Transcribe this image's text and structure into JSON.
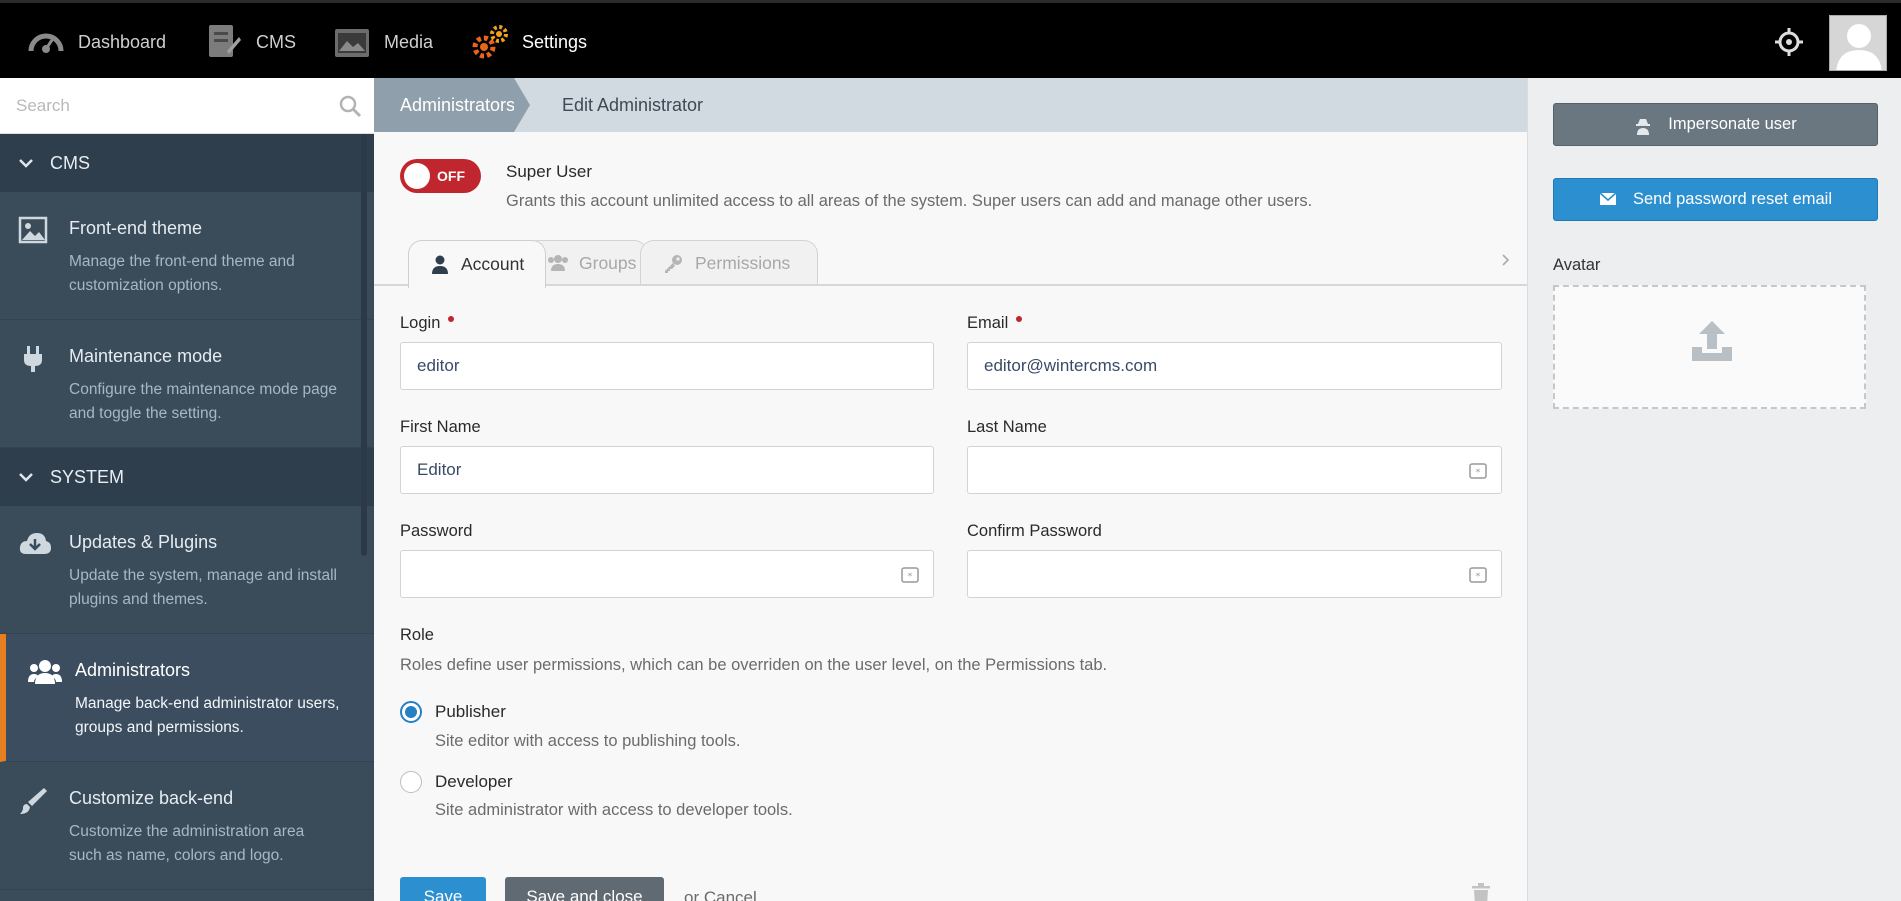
{
  "topnav": {
    "items": [
      {
        "label": "Dashboard",
        "icon": "dashboard-icon"
      },
      {
        "label": "CMS",
        "icon": "cms-icon"
      },
      {
        "label": "Media",
        "icon": "media-icon"
      },
      {
        "label": "Settings",
        "icon": "settings-icon",
        "active": true
      }
    ],
    "locate_icon": "crosshair-icon",
    "avatar_icon": "user-avatar-icon"
  },
  "sidebar": {
    "search_placeholder": "Search",
    "groups": [
      {
        "label": "CMS",
        "items": [
          {
            "title": "Front-end theme",
            "desc": "Manage the front-end theme and customization options.",
            "icon": "image-icon"
          },
          {
            "title": "Maintenance mode",
            "desc": "Configure the maintenance mode page and toggle the setting.",
            "icon": "plug-icon"
          }
        ]
      },
      {
        "label": "SYSTEM",
        "items": [
          {
            "title": "Updates & Plugins",
            "desc": "Update the system, manage and install plugins and themes.",
            "icon": "cloud-download-icon"
          },
          {
            "title": "Administrators",
            "desc": "Manage back-end administrator users, groups and permissions.",
            "icon": "users-icon",
            "active": true
          },
          {
            "title": "Customize back-end",
            "desc": "Customize the administration area such as name, colors and logo.",
            "icon": "brush-icon"
          }
        ]
      }
    ]
  },
  "breadcrumb": {
    "parent": "Administrators",
    "current": "Edit Administrator"
  },
  "form": {
    "super_user": {
      "toggle_text": "OFF",
      "label": "Super User",
      "desc": "Grants this account unlimited access to all areas of the system. Super users can add and manage other users."
    },
    "tabs": [
      {
        "label": "Account",
        "icon": "user-icon",
        "active": true
      },
      {
        "label": "Groups",
        "icon": "users-icon"
      },
      {
        "label": "Permissions",
        "icon": "key-icon"
      }
    ],
    "fields": {
      "login": {
        "label": "Login",
        "value": "editor"
      },
      "email": {
        "label": "Email",
        "value": "editor@wintercms.com"
      },
      "first_name": {
        "label": "First Name",
        "value": "Editor"
      },
      "last_name": {
        "label": "Last Name",
        "value": ""
      },
      "password": {
        "label": "Password",
        "value": ""
      },
      "confirm_password": {
        "label": "Confirm Password",
        "value": ""
      }
    },
    "role": {
      "label": "Role",
      "desc": "Roles define user permissions, which can be overriden on the user level, on the Permissions tab.",
      "options": [
        {
          "label": "Publisher",
          "desc": "Site editor with access to publishing tools.",
          "checked": true
        },
        {
          "label": "Developer",
          "desc": "Site administrator with access to developer tools.",
          "checked": false
        }
      ]
    },
    "actions": {
      "save": "Save",
      "save_close": "Save and close",
      "cancel": "or Cancel"
    }
  },
  "rightpanel": {
    "impersonate": "Impersonate user",
    "reset_email": "Send password reset email",
    "avatar_label": "Avatar"
  },
  "colors": {
    "accent": "#2c8fcf",
    "toggle_off": "#c0262d",
    "active_marker": "#e67e22",
    "sidebar_bg": "#3a4b5a"
  }
}
